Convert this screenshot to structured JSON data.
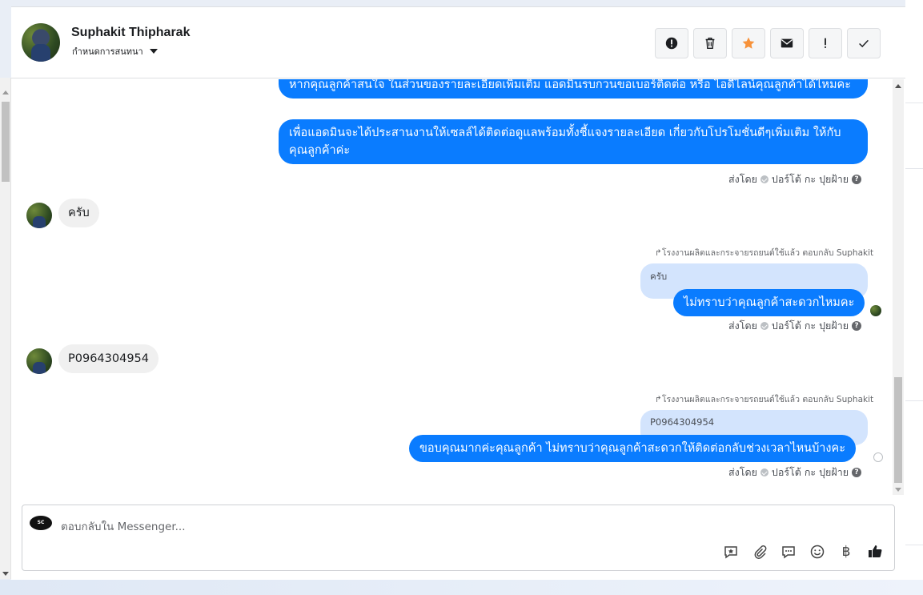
{
  "contact": {
    "name": "Suphakit Thipharak",
    "label_menu": "กำหนดการสนทนา"
  },
  "header_actions": [
    {
      "name": "report-icon"
    },
    {
      "name": "trash-icon"
    },
    {
      "name": "star-icon",
      "color": "#f7923a"
    },
    {
      "name": "mail-icon"
    },
    {
      "name": "exclamation-icon"
    },
    {
      "name": "check-icon"
    }
  ],
  "messages": {
    "out1_text": "หากคุณลูกค้าสนใจ ในส่วนของรายละเอียดเพิ่มเติม แอดมินรบกวนขอเบอร์ติดต่อ หรือ ไอดีไลน์คุณลูกค้าได้ไหมคะ",
    "out2_text": "เพื่อแอดมินจะได้ประสานงานให้เซลล์ได้ติดต่อดูแลพร้อมทั้งชี้แจงรายละเอียด เกี่ยวกับโปรโมชั่นดีๆเพิ่มเติม ให้กับคุณลูกค้าค่ะ",
    "sent_by_label": "ส่งโดย",
    "sender_name": "ปอร์โต้ กะ ปุยฝ้าย",
    "in1_text": "ครับ",
    "reply1_note": "โรงงานผลิตและกระจายรถยนต์ใช้แล้ว ตอบกลับ Suphakit",
    "reply1_quote": "ครับ",
    "out3_text": "ไม่ทราบว่าคุณลูกค้าสะดวกไหมคะ",
    "in2_text": "P0964304954",
    "reply2_note": "โรงงานผลิตและกระจายรถยนต์ใช้แล้ว ตอบกลับ Suphakit",
    "reply2_quote": "P0964304954",
    "out4_text": "ขอบคุณมากค่ะคุณลูกค้า ไม่ทราบว่าคุณลูกค้าสะดวกให้ติดต่อกลับช่วงเวลาไหนบ้างคะ"
  },
  "composer": {
    "placeholder": "ตอบกลับใน Messenger...",
    "currency_symbol": "฿",
    "logo_text": "SC"
  },
  "colors": {
    "outgoing_bubble": "#0a7cff",
    "quoted_bubble": "#d3e4fd",
    "incoming_bubble": "#f0f0f0"
  }
}
